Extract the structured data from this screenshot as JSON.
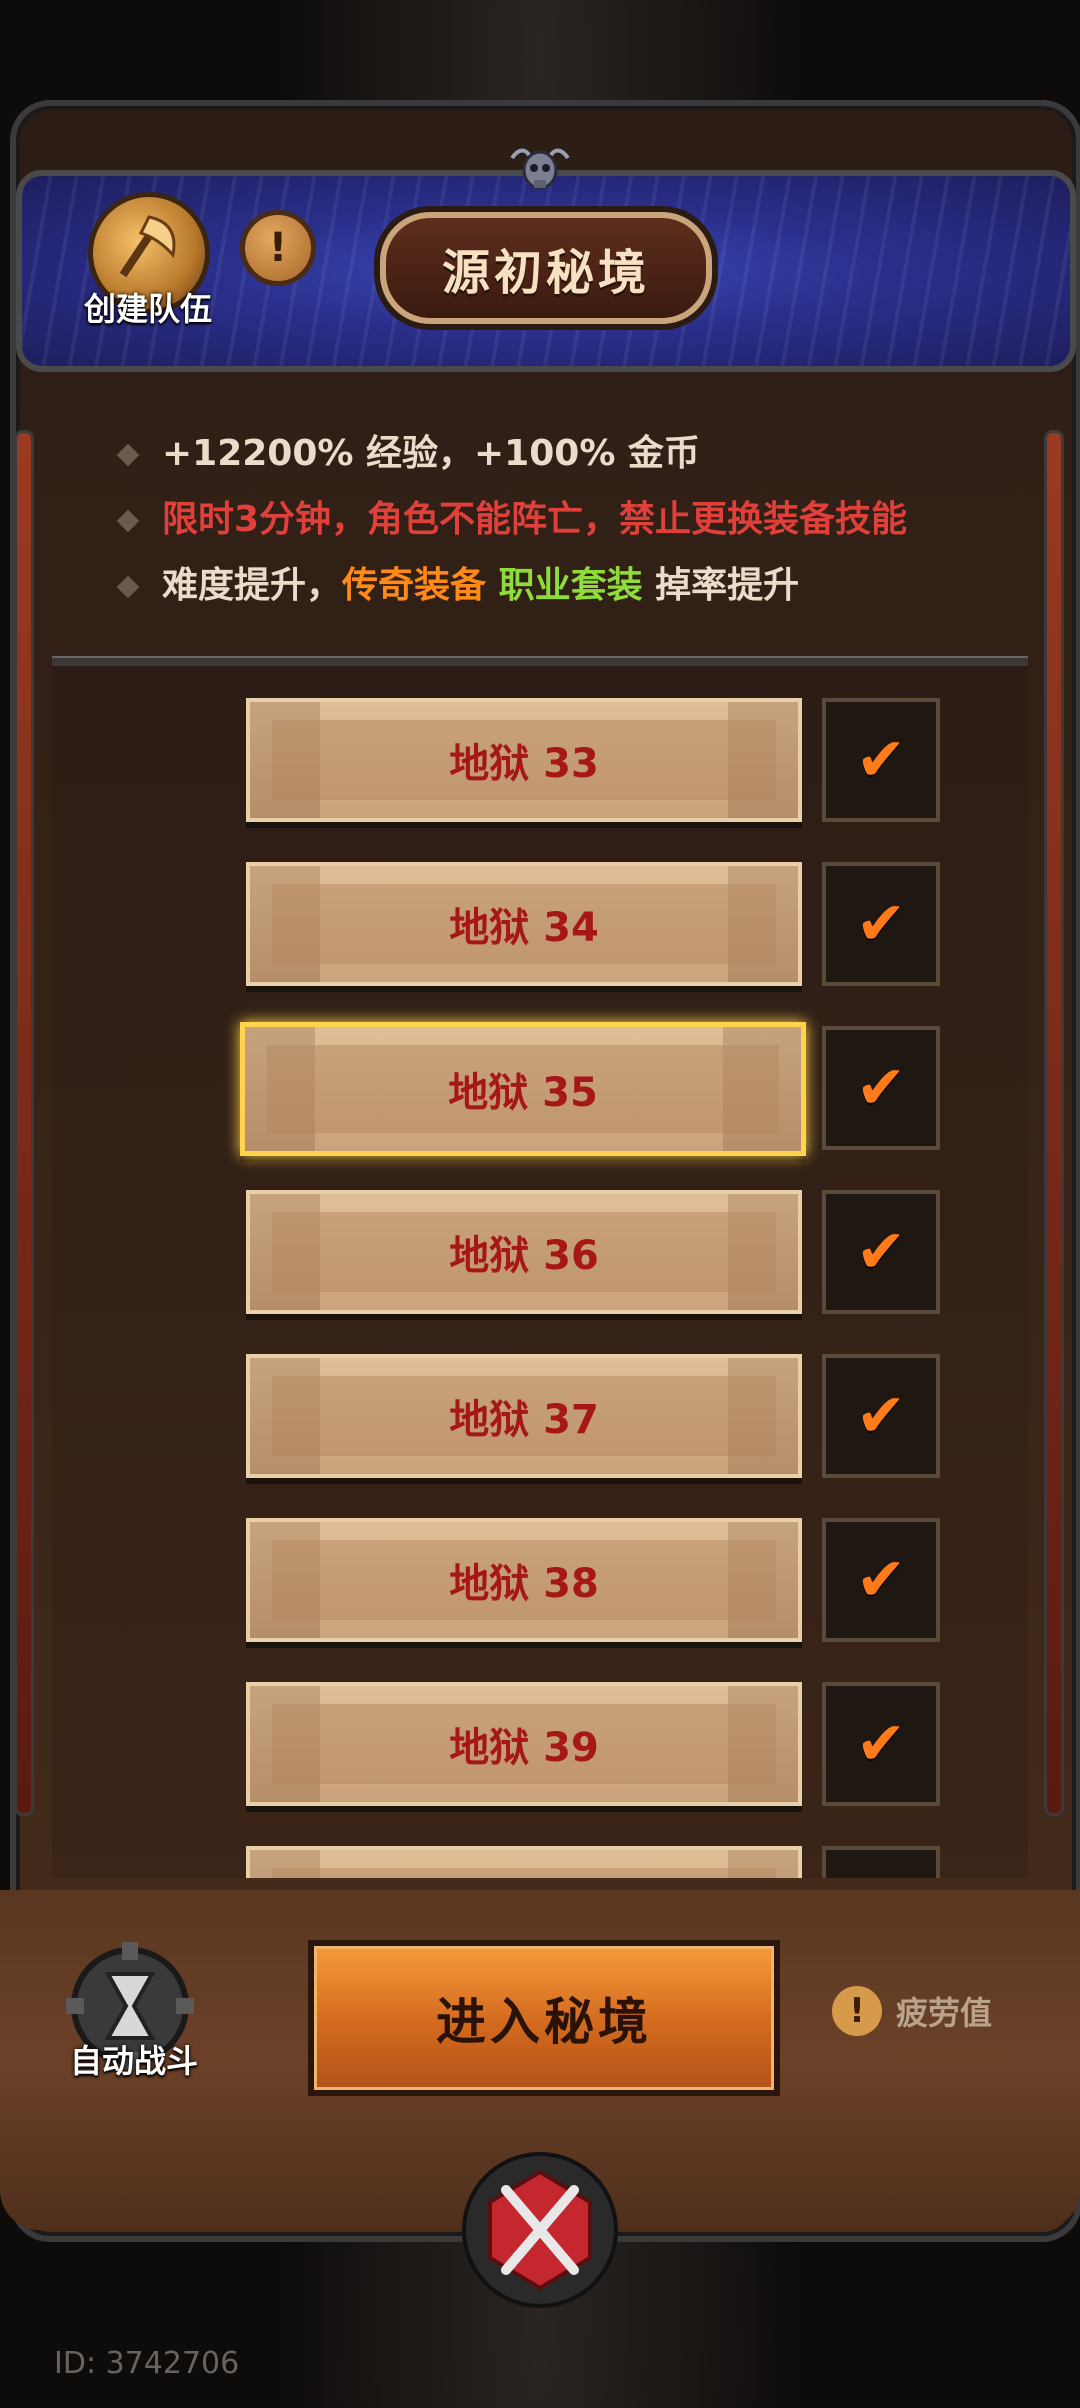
{
  "header": {
    "title": "源初秘境",
    "team_label": "创建队伍",
    "info_glyph": "!"
  },
  "rules": [
    {
      "parts": [
        {
          "text": "+12200% 经验，+100% 金币",
          "color": "default"
        }
      ]
    },
    {
      "parts": [
        {
          "text": "限时3分钟，角色不能阵亡，禁止更换装备技能",
          "color": "red"
        }
      ]
    },
    {
      "parts": [
        {
          "text": "难度提升，",
          "color": "default"
        },
        {
          "text": "传奇装备",
          "color": "orange"
        },
        {
          "text": " 职业套装",
          "color": "green"
        },
        {
          "text": " 掉率提升",
          "color": "default"
        }
      ]
    }
  ],
  "levels": [
    {
      "label": "地狱 33",
      "checked": true,
      "selected": false
    },
    {
      "label": "地狱 34",
      "checked": true,
      "selected": false
    },
    {
      "label": "地狱 35",
      "checked": true,
      "selected": true
    },
    {
      "label": "地狱 36",
      "checked": true,
      "selected": false
    },
    {
      "label": "地狱 37",
      "checked": true,
      "selected": false
    },
    {
      "label": "地狱 38",
      "checked": true,
      "selected": false
    },
    {
      "label": "地狱 39",
      "checked": true,
      "selected": false
    }
  ],
  "footer": {
    "auto_battle_label": "自动战斗",
    "enter_button": "进入秘境",
    "fatigue_label": "疲劳值",
    "fatigue_glyph": "!"
  },
  "player_id": "ID: 3742706",
  "colors": {
    "accent_orange": "#ff8a1a",
    "warning_red": "#e0403a",
    "set_green": "#8edc3c",
    "selected_gold": "#ffd34d"
  }
}
